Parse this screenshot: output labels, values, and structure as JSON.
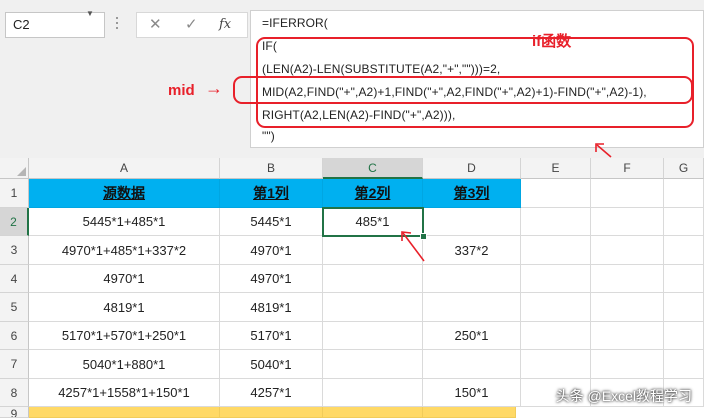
{
  "name_box": {
    "value": "C2"
  },
  "formula_bar": {
    "cancel_icon": "close-icon",
    "enter_icon": "check-icon",
    "fx_label": "fx",
    "lines": [
      "=IFERROR(",
      "IF(",
      "(LEN(A2)-LEN(SUBSTITUTE(A2,\"+\",\"\")))=2,",
      "MID(A2,FIND(\"+\",A2)+1,FIND(\"+\",A2,FIND(\"+\",A2)+1)-FIND(\"+\",A2)-1),",
      "RIGHT(A2,LEN(A2)-FIND(\"+\",A2))),",
      "\"\")"
    ]
  },
  "annotations": {
    "if_label": "if函数",
    "mid_label": "mid",
    "color": "#e8202a"
  },
  "columns": [
    "A",
    "B",
    "C",
    "D",
    "E",
    "F",
    "G"
  ],
  "selected_column": "C",
  "rows": [
    {
      "num": "1",
      "cells": [
        "源数据",
        "第1列",
        "第2列",
        "第3列",
        "",
        "",
        ""
      ]
    },
    {
      "num": "2",
      "cells": [
        "5445*1+485*1",
        "5445*1",
        "485*1",
        "",
        "",
        "",
        ""
      ]
    },
    {
      "num": "3",
      "cells": [
        "4970*1+485*1+337*2",
        "4970*1",
        "",
        "337*2",
        "",
        "",
        ""
      ]
    },
    {
      "num": "4",
      "cells": [
        "4970*1",
        "4970*1",
        "",
        "",
        "",
        "",
        ""
      ]
    },
    {
      "num": "5",
      "cells": [
        "4819*1",
        "4819*1",
        "",
        "",
        "",
        "",
        ""
      ]
    },
    {
      "num": "6",
      "cells": [
        "5170*1+570*1+250*1",
        "5170*1",
        "",
        "250*1",
        "",
        "",
        ""
      ]
    },
    {
      "num": "7",
      "cells": [
        "5040*1+880*1",
        "5040*1",
        "",
        "",
        "",
        "",
        ""
      ]
    },
    {
      "num": "8",
      "cells": [
        "4257*1+1558*1+150*1",
        "4257*1",
        "",
        "150*1",
        "",
        "",
        ""
      ]
    },
    {
      "num": "9",
      "cells": [
        "",
        "",
        "",
        "",
        "",
        "",
        ""
      ]
    }
  ],
  "selected_row": "2",
  "header_fill": "#00b0f0",
  "row9_fill": "#ffd966",
  "watermark": "头条 @Excel教程学习"
}
